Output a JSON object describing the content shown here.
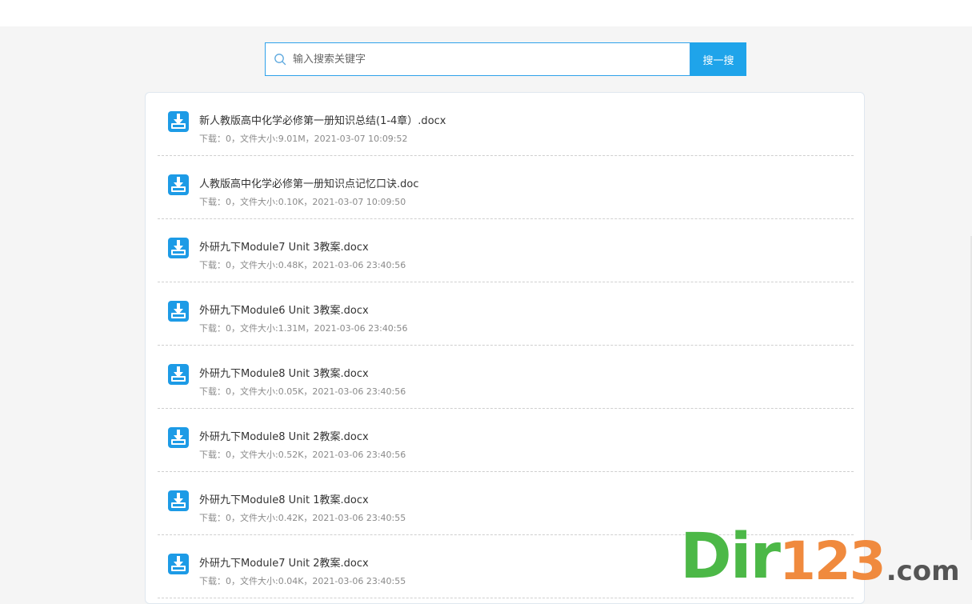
{
  "search": {
    "placeholder": "输入搜索关键字",
    "button_label": "搜一搜"
  },
  "files": [
    {
      "title": "新人教版高中化学必修第一册知识总结(1-4章）.docx",
      "meta": "下载：0，文件大小:9.01M，2021-03-07 10:09:52"
    },
    {
      "title": "人教版高中化学必修第一册知识点记忆口诀.doc",
      "meta": "下载：0，文件大小:0.10K，2021-03-07 10:09:50"
    },
    {
      "title": "外研九下Module7 Unit 3教案.docx",
      "meta": "下载：0，文件大小:0.48K，2021-03-06 23:40:56"
    },
    {
      "title": "外研九下Module6 Unit 3教案.docx",
      "meta": "下载：0，文件大小:1.31M，2021-03-06 23:40:56"
    },
    {
      "title": "外研九下Module8 Unit 3教案.docx",
      "meta": "下载：0，文件大小:0.05K，2021-03-06 23:40:56"
    },
    {
      "title": "外研九下Module8 Unit 2教案.docx",
      "meta": "下载：0，文件大小:0.52K，2021-03-06 23:40:56"
    },
    {
      "title": "外研九下Module8 Unit 1教案.docx",
      "meta": "下载：0，文件大小:0.42K，2021-03-06 23:40:55"
    },
    {
      "title": "外研九下Module7 Unit 2教案.docx",
      "meta": "下载：0，文件大小:0.04K，2021-03-06 23:40:55"
    }
  ],
  "watermark": {
    "part1": "Dir",
    "part2": "123",
    "part3": ".com"
  },
  "colors": {
    "accent": "#1fa4ea",
    "icon_blue": "#1d9be6",
    "watermark_green": "#4cb847",
    "watermark_orange": "#f08a3e"
  },
  "icons": {
    "search": "search-icon",
    "download": "download-icon"
  }
}
